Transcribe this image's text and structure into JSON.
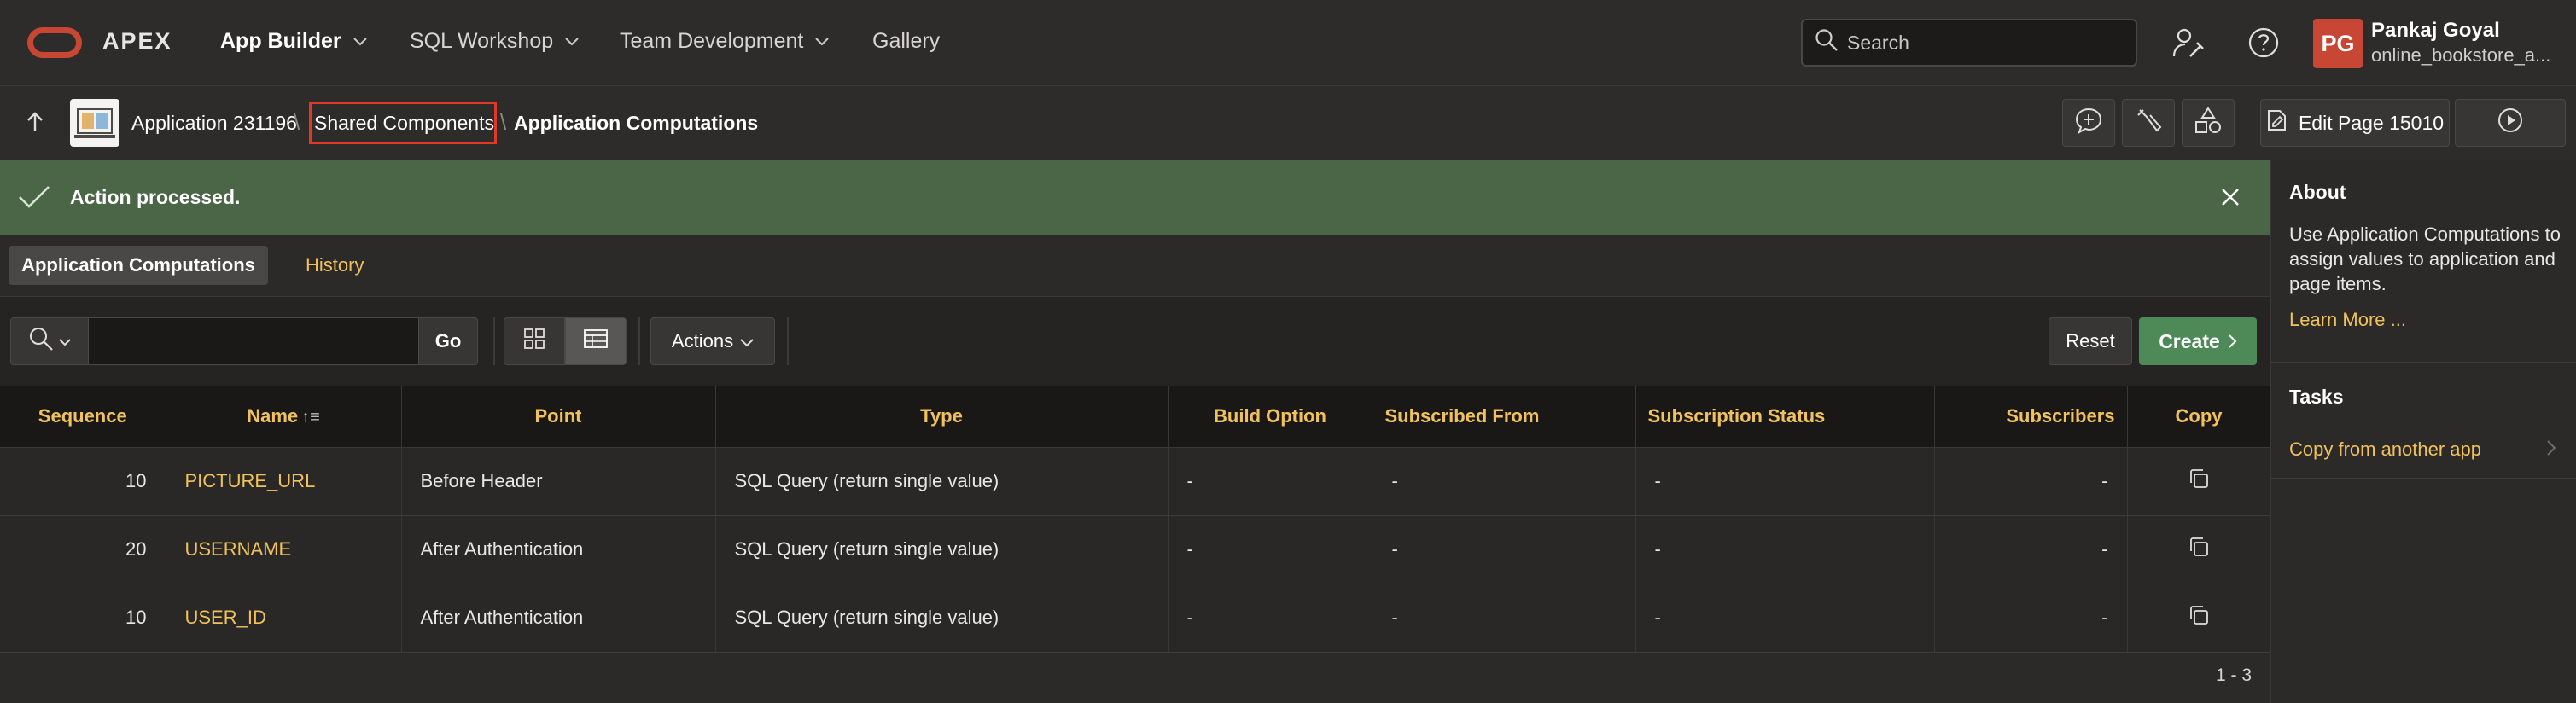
{
  "topbar": {
    "brand": "APEX",
    "nav": [
      {
        "label": "App Builder",
        "active": true
      },
      {
        "label": "SQL Workshop",
        "active": false
      },
      {
        "label": "Team Development",
        "active": false
      },
      {
        "label": "Gallery",
        "active": false
      }
    ],
    "search_placeholder": "Search",
    "user": {
      "initials": "PG",
      "name": "Pankaj Goyal",
      "workspace": "online_bookstore_a..."
    }
  },
  "breadcrumb": {
    "application": "Application 231196",
    "shared_components": "Shared Components",
    "current": "Application Computations",
    "edit_page_label": "Edit Page 15010"
  },
  "banner": {
    "message": "Action processed."
  },
  "tabs": {
    "active": "Application Computations",
    "other": "History"
  },
  "toolbar": {
    "go_label": "Go",
    "actions_label": "Actions",
    "reset_label": "Reset",
    "create_label": "Create"
  },
  "table": {
    "columns": [
      "Sequence",
      "Name",
      "Point",
      "Type",
      "Build Option",
      "Subscribed From",
      "Subscription Status",
      "Subscribers",
      "Copy"
    ],
    "rows": [
      {
        "sequence": "10",
        "name": "PICTURE_URL",
        "point": "Before Header",
        "type": "SQL Query (return single value)",
        "build_option": "-",
        "subscribed_from": "-",
        "subscription_status": "-",
        "subscribers": "-"
      },
      {
        "sequence": "20",
        "name": "USERNAME",
        "point": "After Authentication",
        "type": "SQL Query (return single value)",
        "build_option": "-",
        "subscribed_from": "-",
        "subscription_status": "-",
        "subscribers": "-"
      },
      {
        "sequence": "10",
        "name": "USER_ID",
        "point": "After Authentication",
        "type": "SQL Query (return single value)",
        "build_option": "-",
        "subscribed_from": "-",
        "subscription_status": "-",
        "subscribers": "-"
      }
    ],
    "pagination": "1 - 3"
  },
  "side_panel": {
    "about_heading": "About",
    "about_text": "Use Application Computations to assign values to application and page items.",
    "learn_more": "Learn More ...",
    "tasks_heading": "Tasks",
    "task_copy": "Copy from another app"
  },
  "colors": {
    "accent_link": "#f1c25b",
    "success_banner": "#4b6647",
    "create_button": "#4e8a57",
    "brand_red": "#c74634",
    "highlight_box": "#e03a26"
  }
}
